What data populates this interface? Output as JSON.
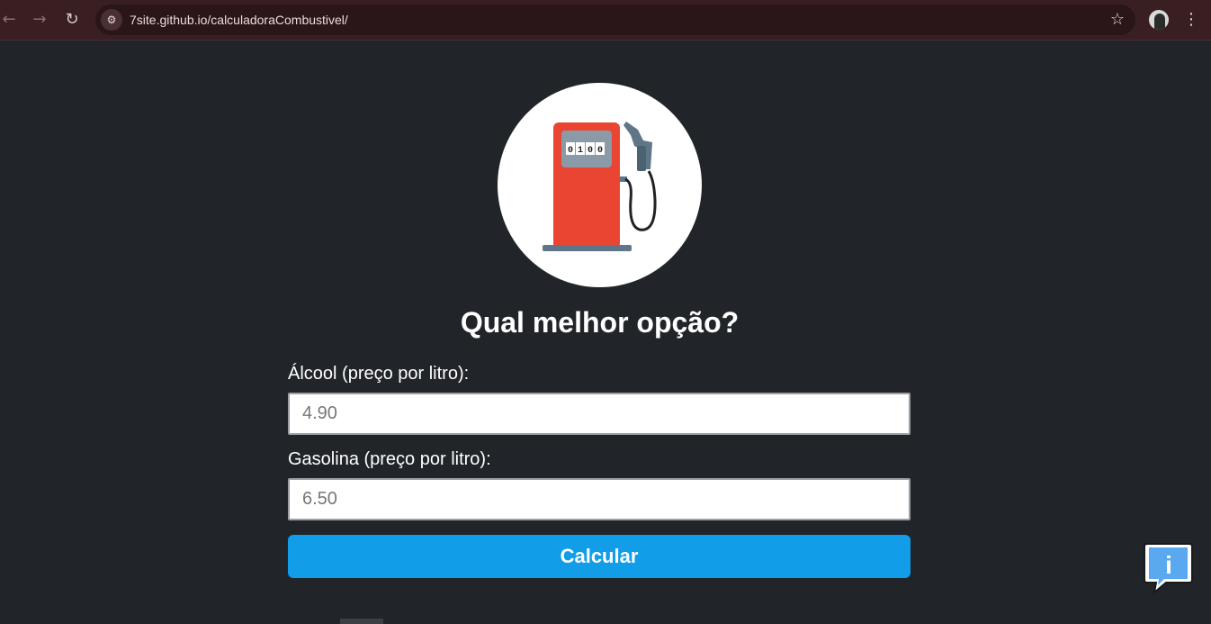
{
  "browser": {
    "url": "7site.github.io/calculadoraCombustivel/",
    "back_glyph": "←",
    "forward_glyph": "→",
    "reload_glyph": "↻",
    "site_info_glyph": "⚙",
    "star_glyph": "☆",
    "menu_glyph": "⋮"
  },
  "logo": {
    "display_digits": [
      "0",
      "1",
      "0",
      "0"
    ],
    "colors": {
      "pump": "#e94532",
      "display": "#8a9aa6",
      "base": "#5e7688"
    }
  },
  "main": {
    "title": "Qual melhor opção?",
    "alcohol": {
      "label": "Álcool (preço por litro):",
      "placeholder": "4.90"
    },
    "gasoline": {
      "label": "Gasolina (preço por litro):",
      "placeholder": "6.50"
    },
    "button_label": "Calcular",
    "accent_color": "#129de8"
  },
  "info_button": {
    "glyph": "i"
  }
}
